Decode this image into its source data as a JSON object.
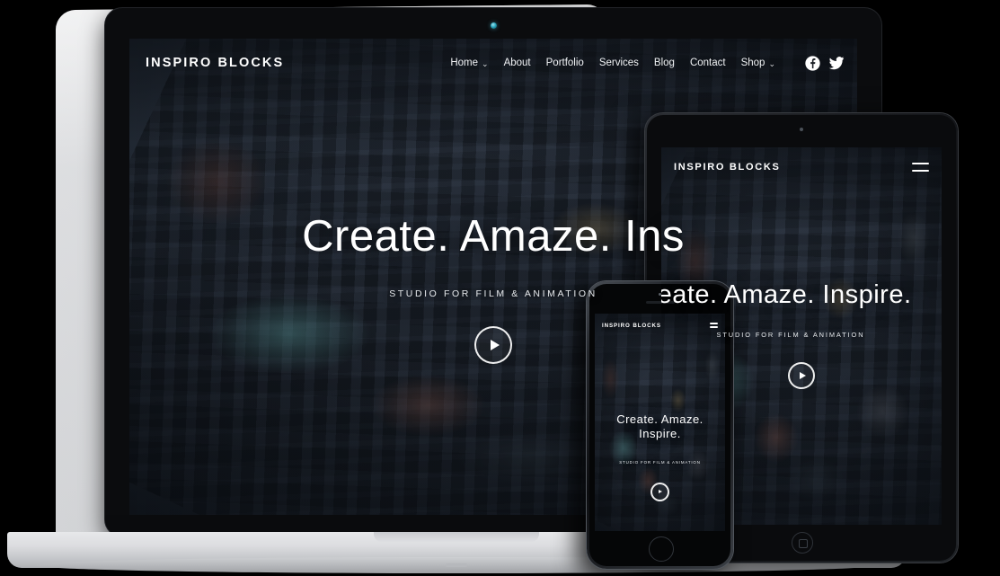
{
  "site": {
    "brand": "INSPIRO BLOCKS",
    "nav": [
      {
        "label": "Home",
        "has_caret": true
      },
      {
        "label": "About",
        "has_caret": false
      },
      {
        "label": "Portfolio",
        "has_caret": false
      },
      {
        "label": "Services",
        "has_caret": false
      },
      {
        "label": "Blog",
        "has_caret": false
      },
      {
        "label": "Contact",
        "has_caret": false
      },
      {
        "label": "Shop",
        "has_caret": true
      }
    ],
    "nav_labels": {
      "home": "Home",
      "about": "About",
      "portfolio": "Portfolio",
      "services": "Services",
      "blog": "Blog",
      "contact": "Contact",
      "shop": "Shop"
    },
    "caret": "⌄",
    "social": {
      "facebook": "facebook-icon",
      "twitter": "twitter-icon"
    },
    "hero": {
      "title_desktop": "Create. Amaze. Ins",
      "title_tablet": "Create. Amaze. Inspire.",
      "title_phone": "Create. Amaze. Inspire.",
      "subtitle": "STUDIO FOR FILM & ANIMATION",
      "play_label": "play-video-button"
    },
    "menu_toggle": "hamburger-menu-icon"
  },
  "devices": {
    "laptop": {
      "name": "laptop",
      "camera": "camera-indicator"
    },
    "tablet": {
      "name": "tablet",
      "camera": "front-camera",
      "home": "home-button"
    },
    "phone": {
      "name": "phone",
      "camera": "front-camera",
      "speaker": "earpiece-speaker",
      "home": "home-button"
    }
  },
  "colors": {
    "background": "#000000",
    "laptop_body": "#dcdde0",
    "device_frame": "#0c0d10",
    "text_light": "#ffffff",
    "accent_camera": "#2aa7bd"
  }
}
